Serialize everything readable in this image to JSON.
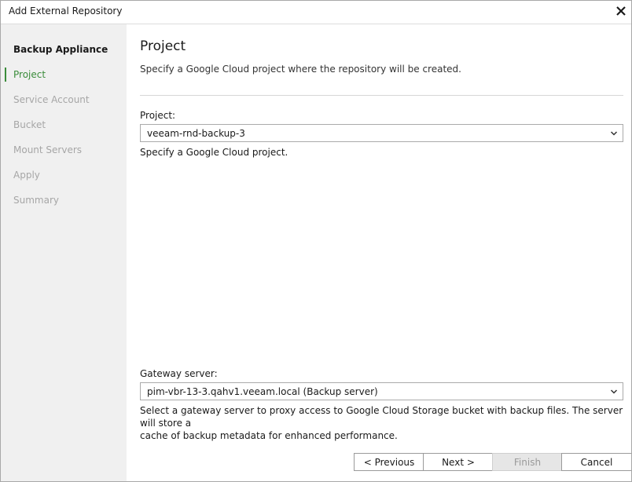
{
  "window": {
    "title": "Add External Repository"
  },
  "sidebar": {
    "steps": [
      {
        "label": "Backup Appliance",
        "state": "done"
      },
      {
        "label": "Project",
        "state": "active"
      },
      {
        "label": "Service Account",
        "state": "pending"
      },
      {
        "label": "Bucket",
        "state": "pending"
      },
      {
        "label": "Mount Servers",
        "state": "pending"
      },
      {
        "label": "Apply",
        "state": "pending"
      },
      {
        "label": "Summary",
        "state": "pending"
      }
    ]
  },
  "main": {
    "title": "Project",
    "description": "Specify a Google Cloud project where the repository will be created.",
    "project": {
      "label": "Project:",
      "value": "veeam-rnd-backup-3",
      "hint": "Specify a Google Cloud project."
    },
    "gateway": {
      "label": "Gateway server:",
      "value": "pim-vbr-13-3.qahv1.veeam.local (Backup server)",
      "hint_line1": "Select a gateway server to proxy access to Google Cloud Storage bucket with backup files. The server will store a",
      "hint_line2": "cache of backup metadata for enhanced performance."
    }
  },
  "buttons": {
    "previous": "< Previous",
    "next": "Next >",
    "finish": "Finish",
    "cancel": "Cancel"
  },
  "colors": {
    "active_step": "#3a8c3a",
    "sidebar_bg": "#f0f0f0",
    "disabled_button_bg": "#e6e6e6"
  }
}
